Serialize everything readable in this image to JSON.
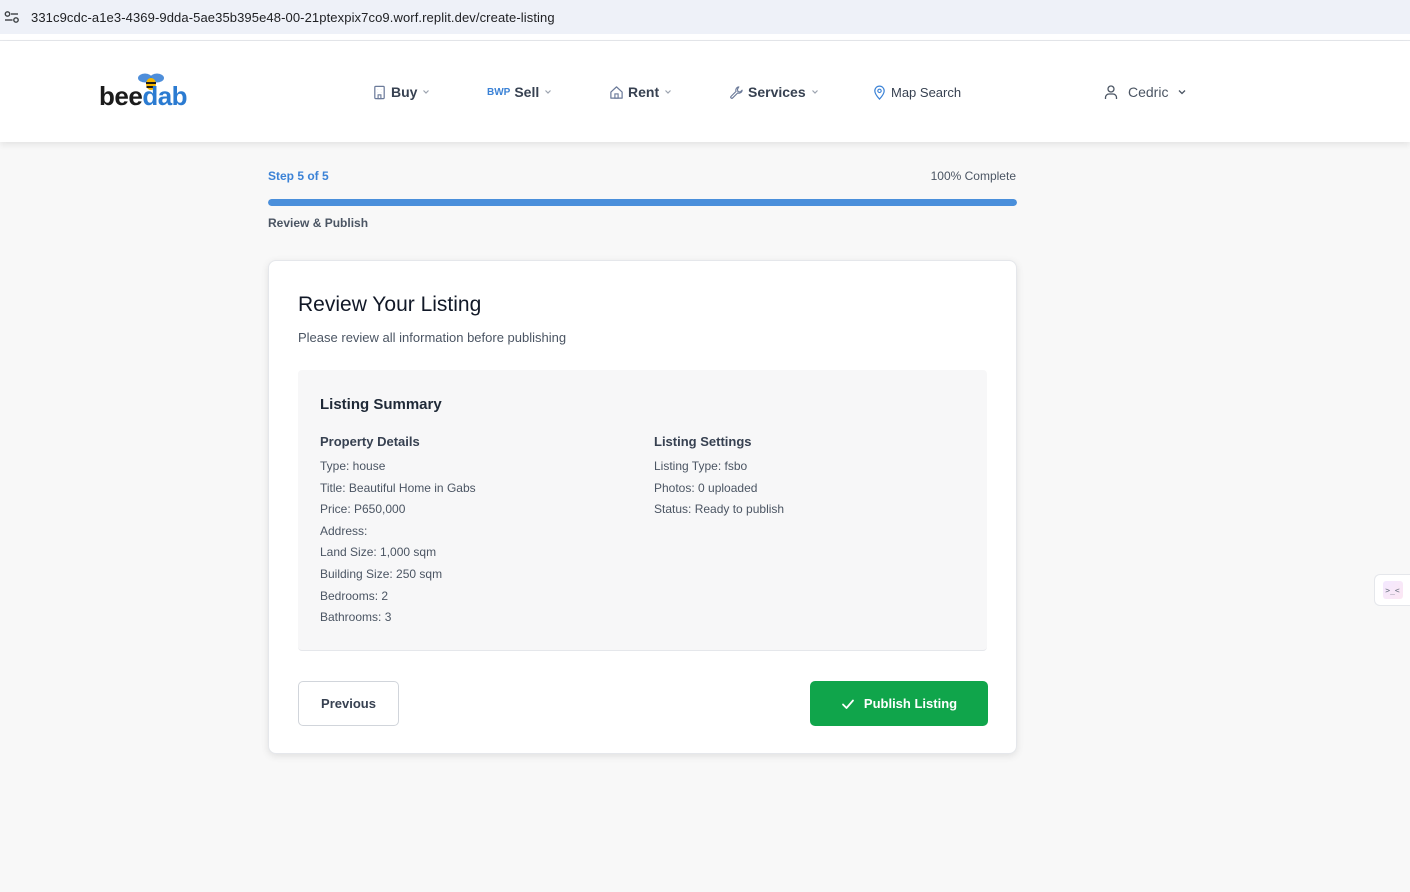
{
  "browser": {
    "url": "331c9cdc-a1e3-4369-9dda-5ae35b395e48-00-21ptexpix7co9.worf.replit.dev/create-listing"
  },
  "header": {
    "logo_bee": "bee",
    "logo_dab": "dab",
    "nav": {
      "buy": "Buy",
      "sell_prefix": "BWP",
      "sell": "Sell",
      "rent": "Rent",
      "services": "Services",
      "map_search": "Map Search"
    },
    "user": "Cedric"
  },
  "progress": {
    "step": "Step 5 of 5",
    "percent_label": "100% Complete",
    "percent": 100,
    "step_name": "Review & Publish"
  },
  "card": {
    "title": "Review Your Listing",
    "subtitle": "Please review all information before publishing",
    "summary_title": "Listing Summary",
    "property": {
      "heading": "Property Details",
      "lines": [
        "Type: house",
        "Title: Beautiful Home in Gabs",
        "Price: P650,000",
        "Address:",
        "Land Size: 1,000 sqm",
        "Building Size: 250 sqm",
        "Bedrooms: 2",
        "Bathrooms: 3"
      ]
    },
    "settings": {
      "heading": "Listing Settings",
      "lines": [
        "Listing Type: fsbo",
        "Photos: 0 uploaded",
        "Status: Ready to publish"
      ]
    },
    "previous_label": "Previous",
    "publish_label": "Publish Listing"
  },
  "side_widget": {
    "glyph": ">_<"
  },
  "colors": {
    "accent_blue": "#3b82d6",
    "progress_fill": "#4a8fdb",
    "publish_green": "#10a54b",
    "page_bg": "#f8f8f8"
  }
}
